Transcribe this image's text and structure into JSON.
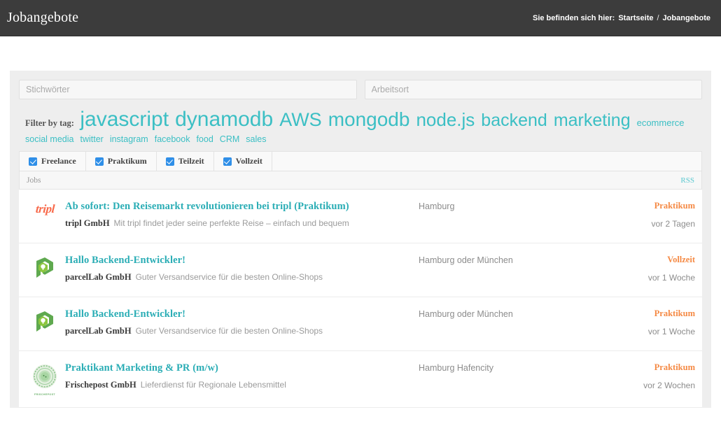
{
  "header": {
    "title": "Jobangebote",
    "breadcrumb_prefix": "Sie befinden sich hier:",
    "breadcrumb_home": "Startseite",
    "breadcrumb_sep": "/",
    "breadcrumb_current": "Jobangebote"
  },
  "search": {
    "keywords_placeholder": "Stichwörter",
    "keywords_value": "",
    "location_placeholder": "Arbeitsort",
    "location_value": ""
  },
  "tagcloud": {
    "label": "Filter by tag:",
    "accent_color": "#3bbfc4",
    "tags": [
      {
        "label": "javascript",
        "size": 30
      },
      {
        "label": "dynamodb",
        "size": 30
      },
      {
        "label": "AWS",
        "size": 27
      },
      {
        "label": "mongodb",
        "size": 28
      },
      {
        "label": "node.js",
        "size": 26
      },
      {
        "label": "backend",
        "size": 25
      },
      {
        "label": "marketing",
        "size": 25
      },
      {
        "label": "ecommerce",
        "size": 13
      }
    ],
    "tags_small": [
      "social media",
      "twitter",
      "instagram",
      "facebook",
      "food",
      "CRM",
      "sales"
    ]
  },
  "filters": {
    "checkbox_color": "#2f8fe8",
    "items": [
      {
        "label": "Freelance",
        "checked": true
      },
      {
        "label": "Praktikum",
        "checked": true
      },
      {
        "label": "Teilzeit",
        "checked": true
      },
      {
        "label": "Vollzeit",
        "checked": true
      }
    ]
  },
  "jobs_header": {
    "title": "Jobs",
    "rss_label": "RSS"
  },
  "jobs": [
    {
      "logo": "tripl-logo",
      "title": "Ab sofort: Den Reisemarkt revolutionieren bei tripl (Praktikum)",
      "company": "tripl GmbH",
      "tagline": "Mit tripl findet jeder seine perfekte Reise – einfach und bequem",
      "location": "Hamburg",
      "type": "Praktikum",
      "age": "vor 2 Tagen"
    },
    {
      "logo": "parcellab-logo",
      "title": "Hallo Backend-Entwickler!",
      "company": "parcelLab GmbH",
      "tagline": "Guter Versandservice für die besten Online-Shops",
      "location": "Hamburg oder München",
      "type": "Vollzeit",
      "age": "vor 1 Woche"
    },
    {
      "logo": "parcellab-logo",
      "title": "Hallo Backend-Entwickler!",
      "company": "parcelLab GmbH",
      "tagline": "Guter Versandservice für die besten Online-Shops",
      "location": "Hamburg oder München",
      "type": "Praktikum",
      "age": "vor 1 Woche"
    },
    {
      "logo": "frischepost-logo",
      "title": "Praktikant Marketing & PR (m/w)",
      "company": "Frischepost GmbH",
      "tagline": "Lieferdienst für Regionale Lebensmittel",
      "location": "Hamburg Hafencity",
      "type": "Praktikum",
      "age": "vor 2 Wochen"
    }
  ],
  "logo_text": {
    "tripl": "tripl",
    "frischepost_caption": "FRISCHEPOST"
  }
}
